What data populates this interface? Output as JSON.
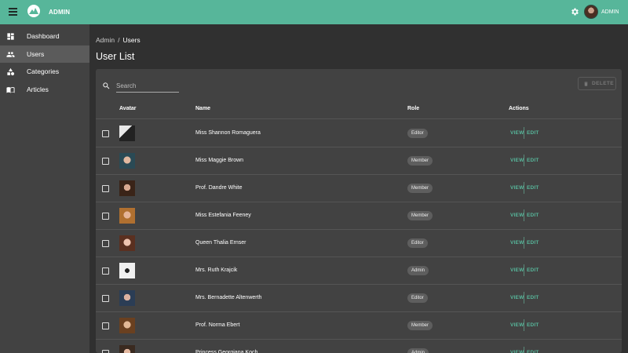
{
  "app": {
    "title": "ADMIN",
    "user_label": "ADMIN",
    "accent": "#57b69a"
  },
  "icons": {
    "menu": "menu-icon",
    "logo": "mountain-logo-icon",
    "settings": "gear-icon",
    "search": "search-icon",
    "delete": "trash-icon"
  },
  "sidebar": {
    "items": [
      {
        "label": "Dashboard",
        "icon": "dashboard-icon",
        "active": false
      },
      {
        "label": "Users",
        "icon": "people-icon",
        "active": true
      },
      {
        "label": "Categories",
        "icon": "shapes-icon",
        "active": false
      },
      {
        "label": "Articles",
        "icon": "book-icon",
        "active": false
      }
    ]
  },
  "breadcrumb": {
    "root": "Admin",
    "separator": "/",
    "current": "Users"
  },
  "page": {
    "title": "User List"
  },
  "toolbar": {
    "search_placeholder": "Search",
    "delete_label": "DELETE"
  },
  "table": {
    "headers": {
      "avatar": "Avatar",
      "name": "Name",
      "role": "Role",
      "actions": "Actions"
    },
    "view_label": "VIEW",
    "edit_label": "EDIT",
    "rows": [
      {
        "name": "Miss Shannon Romaguera",
        "role": "Editor"
      },
      {
        "name": "Miss Maggie Brown",
        "role": "Member"
      },
      {
        "name": "Prof. Dandre White",
        "role": "Member"
      },
      {
        "name": "Miss Estefania Feeney",
        "role": "Member"
      },
      {
        "name": "Queen Thalia Ernser",
        "role": "Editor"
      },
      {
        "name": "Mrs. Ruth Krajcik",
        "role": "Admin"
      },
      {
        "name": "Mrs. Bernadette Altenwerth",
        "role": "Editor"
      },
      {
        "name": "Prof. Norma Ebert",
        "role": "Member"
      },
      {
        "name": "Princess Georgiana Koch",
        "role": "Admin"
      }
    ]
  }
}
